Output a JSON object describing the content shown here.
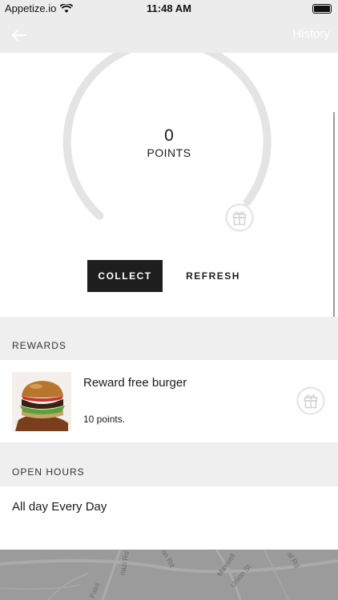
{
  "status_bar": {
    "carrier": "Appetize.io",
    "time": "11:48 AM"
  },
  "nav": {
    "history_label": "History"
  },
  "points": {
    "value": "0",
    "label": "POINTS",
    "progress": 0
  },
  "actions": {
    "collect_label": "COLLECT",
    "refresh_label": "REFRESH"
  },
  "rewards": {
    "header": "REWARDS",
    "items": [
      {
        "title": "Reward free burger",
        "points": "10 points."
      }
    ]
  },
  "open_hours": {
    "header": "OPEN HOURS",
    "text": "All day Every Day"
  },
  "map": {
    "streets": [
      "nazi Rd",
      "an Rd",
      "Maxwell",
      "Union St",
      "al Rd",
      "Pass"
    ]
  },
  "colors": {
    "button_dark": "#1e1e1e",
    "section_bg": "#efefef",
    "gauge_track": "#e4e4e4"
  }
}
